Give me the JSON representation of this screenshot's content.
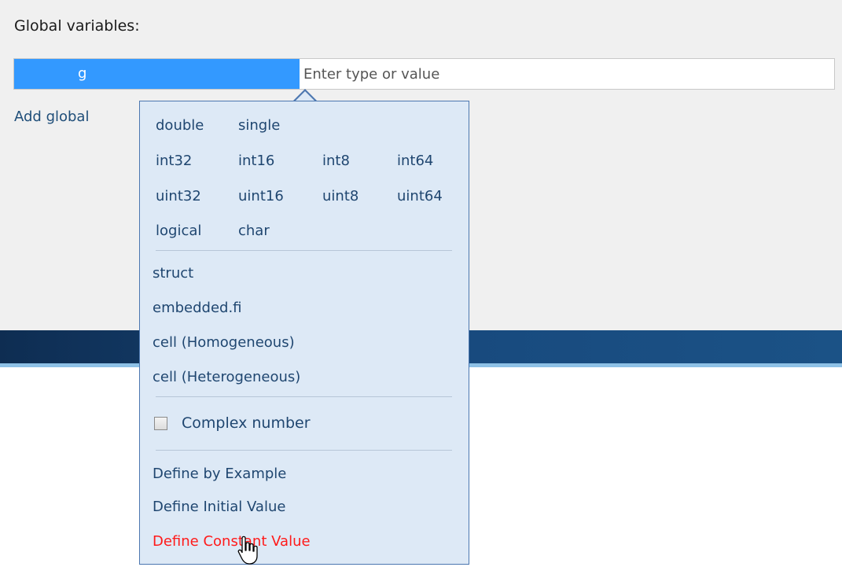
{
  "section_title": "Global variables:",
  "variable": {
    "name": "g",
    "type_placeholder": "Enter type or value"
  },
  "add_global_label": "Add global",
  "popup": {
    "numeric_types": [
      [
        "double",
        "single"
      ],
      [
        "int32",
        "int16",
        "int8",
        "int64"
      ],
      [
        "uint32",
        "uint16",
        "uint8",
        "uint64"
      ],
      [
        "logical",
        "char"
      ]
    ],
    "compound_types": [
      "struct",
      "embedded.fi",
      "cell (Homogeneous)",
      "cell (Heterogeneous)"
    ],
    "complex_checkbox": {
      "label": "Complex number",
      "checked": false
    },
    "define_actions": [
      "Define by Example",
      "Define Initial Value",
      "Define Constant Value"
    ],
    "hovered_action": "Define Constant Value"
  },
  "colors": {
    "selection_blue": "#3399ff",
    "popup_bg": "#dde9f6",
    "link_text": "#1f4670",
    "hover_red": "#ff1a1a",
    "dark_band": "#184a7e"
  },
  "cursor": "hand-pointer-icon"
}
